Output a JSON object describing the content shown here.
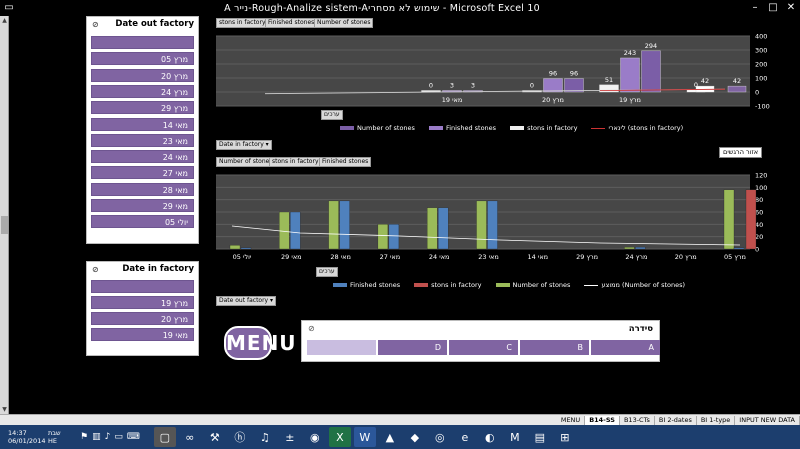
{
  "window": {
    "title": "A נייר-Rough-Analize sistem-Aשימוש לא מסחרי - Microsoft Excel 10"
  },
  "slicer_out": {
    "title": "Date out factory",
    "items": [
      "",
      "05 מרץ",
      "20 מרץ",
      "24 מרץ",
      "29 מרץ",
      "14 מאי",
      "23 מאי",
      "24 מאי",
      "27 מאי",
      "28 מאי",
      "29 מאי",
      "05 יולי"
    ]
  },
  "slicer_in": {
    "title": "Date in factory",
    "items": [
      "",
      "19 מרץ",
      "20 מרץ",
      "19 מאי"
    ]
  },
  "chart_top": {
    "field_buttons": [
      "stons in factory",
      "Finished stones",
      "Number of stones"
    ],
    "axis_button": "ערכים",
    "filter_button": "Date in factory",
    "legend": [
      "Number of stones",
      "Finished stones",
      "stons in factory",
      "לינארי (stons in factory)"
    ]
  },
  "chart_bottom": {
    "field_buttons": [
      "Number of stones",
      "stons in factory",
      "Finished stones"
    ],
    "axis_button": "ערכים",
    "filter_button": "Date out factory",
    "clear_label": "אזור הרגשים",
    "legend": [
      "Finished stones",
      "stons in factory",
      "Number of stones",
      "ממוצע (Number of stones)"
    ]
  },
  "menu_button": "MENU",
  "series_slicer": {
    "title": "סידרה",
    "items": [
      "",
      "D",
      "C",
      "B",
      "A"
    ]
  },
  "sheet_tabs": [
    "MENU",
    "B14-SS",
    "B13-CTs",
    "BI 2-dates",
    "BI 1-type",
    "INPUT NEW DATA"
  ],
  "active_tab": "B14-SS",
  "tray": {
    "time": "14:37",
    "date": "06/01/2014",
    "lang": "HE",
    "day": "שבת"
  },
  "chart_data": [
    {
      "type": "bar",
      "categories": [
        "19 מרץ",
        "20 מרץ",
        "19 מאי"
      ],
      "series": [
        {
          "name": "Number of stones",
          "values": [
            294,
            96,
            3
          ]
        },
        {
          "name": "Finished stones",
          "values": [
            243,
            96,
            3
          ]
        },
        {
          "name": "stons in factory",
          "values": [
            51,
            0,
            0
          ]
        }
      ],
      "extra_bars": [
        {
          "value": 42,
          "color": "#8064a2"
        },
        {
          "value": 0,
          "color": "#fff"
        },
        {
          "value": 42,
          "color": "#fff"
        }
      ],
      "ylim": [
        -100,
        400
      ],
      "yticks": [
        -100,
        0,
        100,
        200,
        300,
        400
      ]
    },
    {
      "type": "bar",
      "categories": [
        "05 יולי",
        "29 מאי",
        "28 מאי",
        "27 מאי",
        "24 מאי",
        "23 מאי",
        "14 מאי",
        "29 מרץ",
        "24 מרץ",
        "20 מרץ",
        "05 מרץ"
      ],
      "series": [
        {
          "name": "Number of stones",
          "values": [
            6,
            60,
            78,
            40,
            67,
            78,
            0,
            0,
            3,
            0,
            96
          ]
        },
        {
          "name": "Finished stones",
          "values": [
            2,
            60,
            78,
            40,
            67,
            78,
            0,
            0,
            3,
            0,
            2
          ]
        },
        {
          "name": "stons in factory",
          "values": [
            0,
            0,
            0,
            0,
            0,
            0,
            0,
            0,
            0,
            0,
            96
          ]
        }
      ],
      "ylim": [
        0,
        120
      ],
      "yticks": [
        0,
        20,
        40,
        60,
        80,
        100,
        120
      ]
    }
  ]
}
